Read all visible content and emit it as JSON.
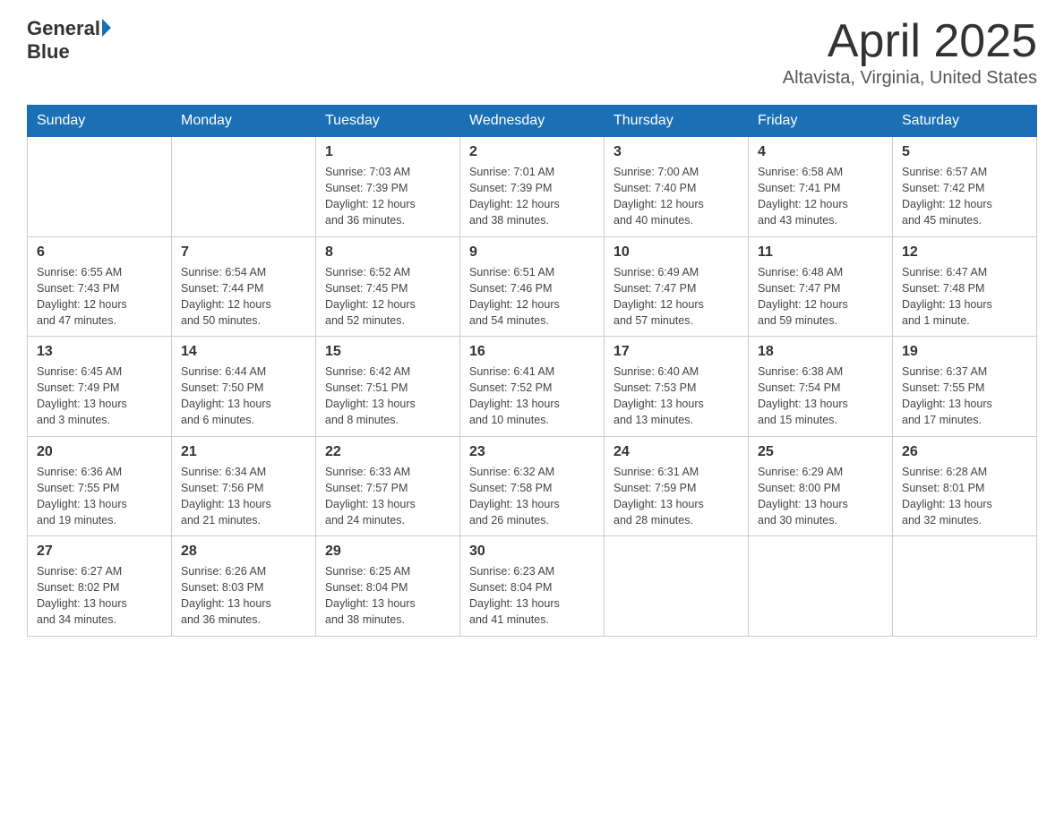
{
  "header": {
    "logo_general": "General",
    "logo_blue": "Blue",
    "month_title": "April 2025",
    "location": "Altavista, Virginia, United States"
  },
  "weekdays": [
    "Sunday",
    "Monday",
    "Tuesday",
    "Wednesday",
    "Thursday",
    "Friday",
    "Saturday"
  ],
  "weeks": [
    [
      {
        "day": "",
        "info": ""
      },
      {
        "day": "",
        "info": ""
      },
      {
        "day": "1",
        "info": "Sunrise: 7:03 AM\nSunset: 7:39 PM\nDaylight: 12 hours\nand 36 minutes."
      },
      {
        "day": "2",
        "info": "Sunrise: 7:01 AM\nSunset: 7:39 PM\nDaylight: 12 hours\nand 38 minutes."
      },
      {
        "day": "3",
        "info": "Sunrise: 7:00 AM\nSunset: 7:40 PM\nDaylight: 12 hours\nand 40 minutes."
      },
      {
        "day": "4",
        "info": "Sunrise: 6:58 AM\nSunset: 7:41 PM\nDaylight: 12 hours\nand 43 minutes."
      },
      {
        "day": "5",
        "info": "Sunrise: 6:57 AM\nSunset: 7:42 PM\nDaylight: 12 hours\nand 45 minutes."
      }
    ],
    [
      {
        "day": "6",
        "info": "Sunrise: 6:55 AM\nSunset: 7:43 PM\nDaylight: 12 hours\nand 47 minutes."
      },
      {
        "day": "7",
        "info": "Sunrise: 6:54 AM\nSunset: 7:44 PM\nDaylight: 12 hours\nand 50 minutes."
      },
      {
        "day": "8",
        "info": "Sunrise: 6:52 AM\nSunset: 7:45 PM\nDaylight: 12 hours\nand 52 minutes."
      },
      {
        "day": "9",
        "info": "Sunrise: 6:51 AM\nSunset: 7:46 PM\nDaylight: 12 hours\nand 54 minutes."
      },
      {
        "day": "10",
        "info": "Sunrise: 6:49 AM\nSunset: 7:47 PM\nDaylight: 12 hours\nand 57 minutes."
      },
      {
        "day": "11",
        "info": "Sunrise: 6:48 AM\nSunset: 7:47 PM\nDaylight: 12 hours\nand 59 minutes."
      },
      {
        "day": "12",
        "info": "Sunrise: 6:47 AM\nSunset: 7:48 PM\nDaylight: 13 hours\nand 1 minute."
      }
    ],
    [
      {
        "day": "13",
        "info": "Sunrise: 6:45 AM\nSunset: 7:49 PM\nDaylight: 13 hours\nand 3 minutes."
      },
      {
        "day": "14",
        "info": "Sunrise: 6:44 AM\nSunset: 7:50 PM\nDaylight: 13 hours\nand 6 minutes."
      },
      {
        "day": "15",
        "info": "Sunrise: 6:42 AM\nSunset: 7:51 PM\nDaylight: 13 hours\nand 8 minutes."
      },
      {
        "day": "16",
        "info": "Sunrise: 6:41 AM\nSunset: 7:52 PM\nDaylight: 13 hours\nand 10 minutes."
      },
      {
        "day": "17",
        "info": "Sunrise: 6:40 AM\nSunset: 7:53 PM\nDaylight: 13 hours\nand 13 minutes."
      },
      {
        "day": "18",
        "info": "Sunrise: 6:38 AM\nSunset: 7:54 PM\nDaylight: 13 hours\nand 15 minutes."
      },
      {
        "day": "19",
        "info": "Sunrise: 6:37 AM\nSunset: 7:55 PM\nDaylight: 13 hours\nand 17 minutes."
      }
    ],
    [
      {
        "day": "20",
        "info": "Sunrise: 6:36 AM\nSunset: 7:55 PM\nDaylight: 13 hours\nand 19 minutes."
      },
      {
        "day": "21",
        "info": "Sunrise: 6:34 AM\nSunset: 7:56 PM\nDaylight: 13 hours\nand 21 minutes."
      },
      {
        "day": "22",
        "info": "Sunrise: 6:33 AM\nSunset: 7:57 PM\nDaylight: 13 hours\nand 24 minutes."
      },
      {
        "day": "23",
        "info": "Sunrise: 6:32 AM\nSunset: 7:58 PM\nDaylight: 13 hours\nand 26 minutes."
      },
      {
        "day": "24",
        "info": "Sunrise: 6:31 AM\nSunset: 7:59 PM\nDaylight: 13 hours\nand 28 minutes."
      },
      {
        "day": "25",
        "info": "Sunrise: 6:29 AM\nSunset: 8:00 PM\nDaylight: 13 hours\nand 30 minutes."
      },
      {
        "day": "26",
        "info": "Sunrise: 6:28 AM\nSunset: 8:01 PM\nDaylight: 13 hours\nand 32 minutes."
      }
    ],
    [
      {
        "day": "27",
        "info": "Sunrise: 6:27 AM\nSunset: 8:02 PM\nDaylight: 13 hours\nand 34 minutes."
      },
      {
        "day": "28",
        "info": "Sunrise: 6:26 AM\nSunset: 8:03 PM\nDaylight: 13 hours\nand 36 minutes."
      },
      {
        "day": "29",
        "info": "Sunrise: 6:25 AM\nSunset: 8:04 PM\nDaylight: 13 hours\nand 38 minutes."
      },
      {
        "day": "30",
        "info": "Sunrise: 6:23 AM\nSunset: 8:04 PM\nDaylight: 13 hours\nand 41 minutes."
      },
      {
        "day": "",
        "info": ""
      },
      {
        "day": "",
        "info": ""
      },
      {
        "day": "",
        "info": ""
      }
    ]
  ]
}
